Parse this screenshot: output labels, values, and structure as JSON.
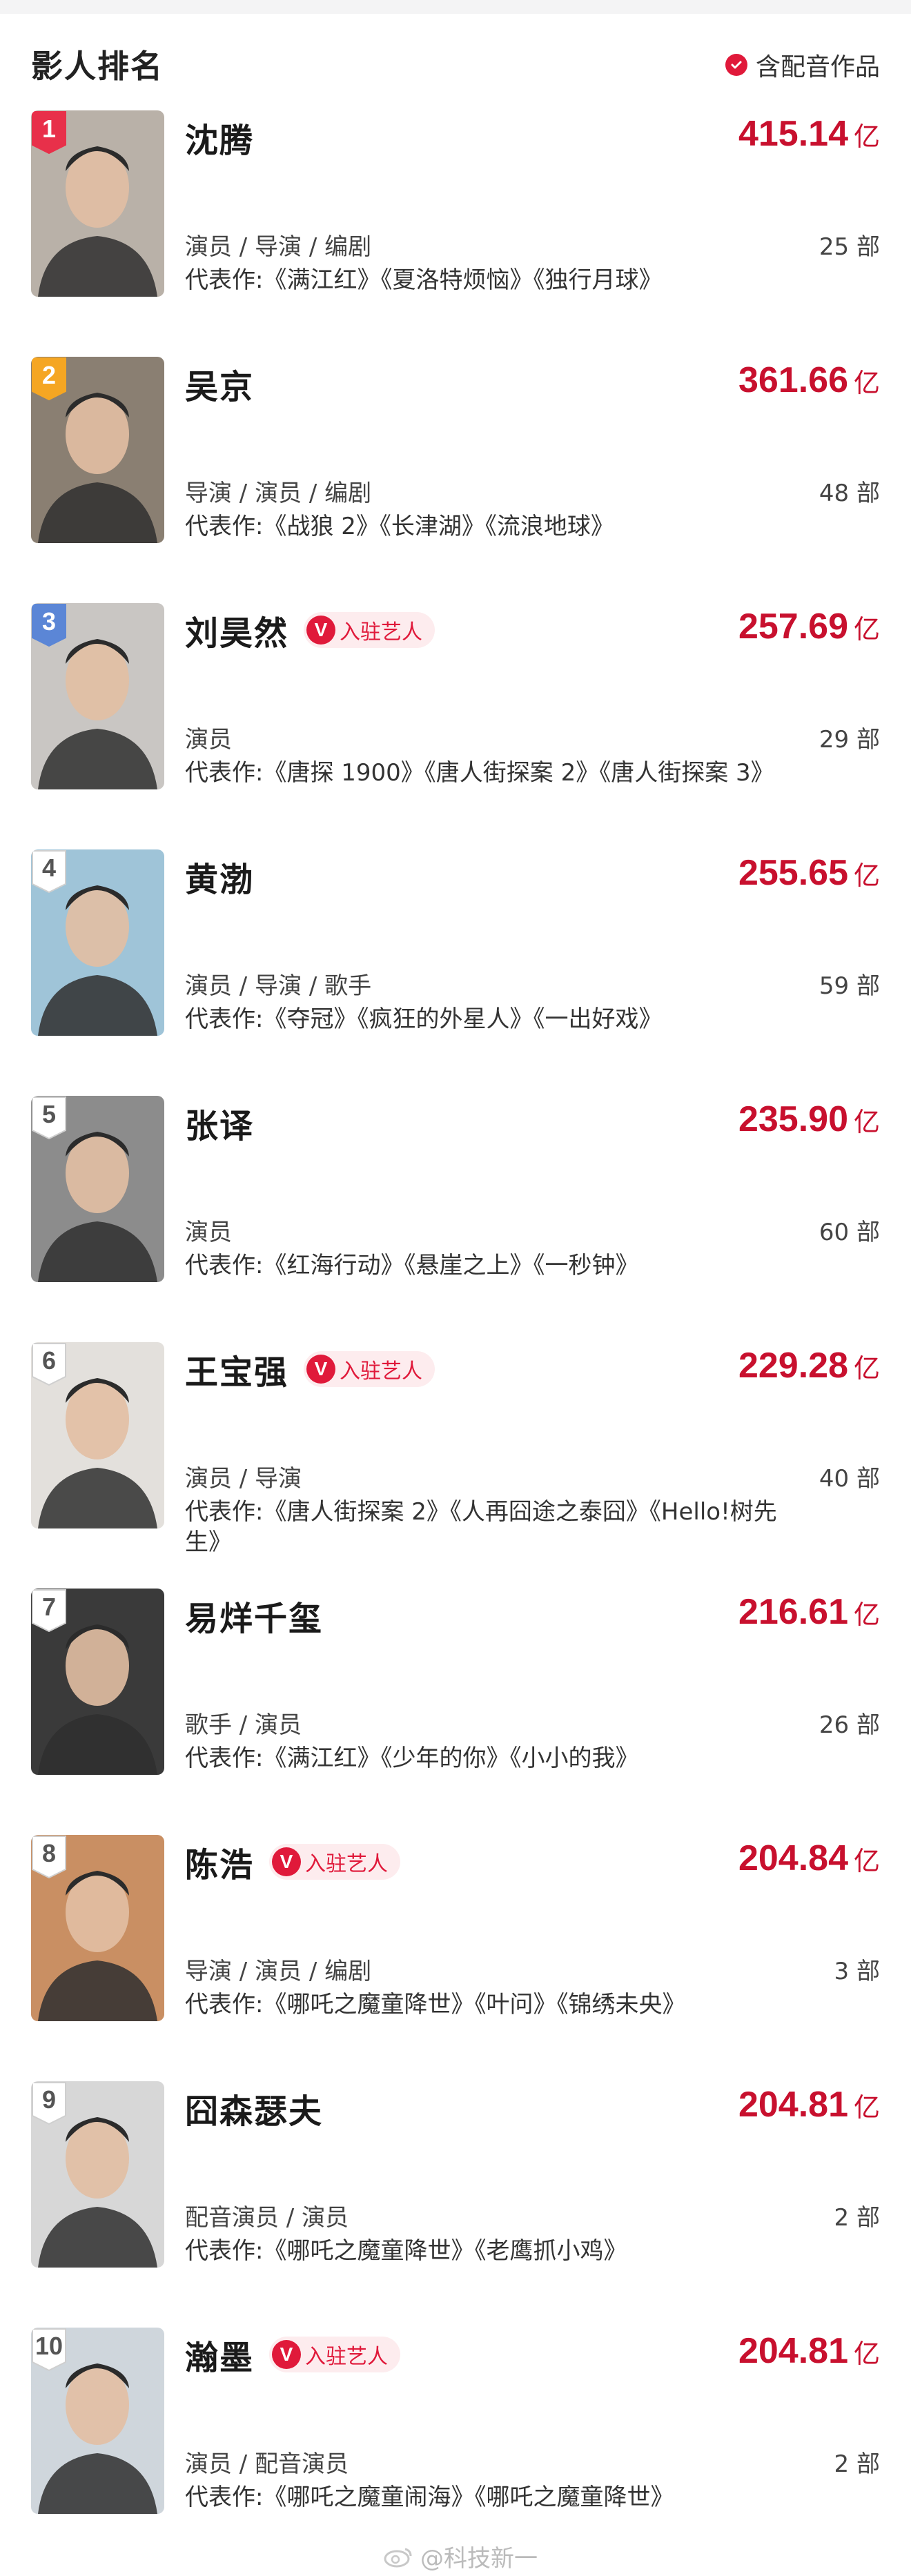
{
  "header": {
    "title": "影人排名",
    "filter_label": "含配音作品"
  },
  "colors": {
    "accent": "#c8102e",
    "badge_red": "#e8304a",
    "badge_orange": "#f5a623",
    "badge_blue": "#5b86d6",
    "badge_plain": "#ffffff"
  },
  "verified_label": "入驻艺人",
  "verified_v": "V",
  "box_unit": "亿",
  "rows": [
    {
      "rank": "1",
      "name": "沈腾",
      "box": "415.14",
      "roles": "演员 / 导演 / 编剧",
      "count": "25 部",
      "works": "代表作:《满江红》《夏洛特烦恼》《独行月球》",
      "verified": false,
      "badge": "red",
      "photo": "#b9b1a8"
    },
    {
      "rank": "2",
      "name": "吴京",
      "box": "361.66",
      "roles": "导演 / 演员 / 编剧",
      "count": "48 部",
      "works": "代表作:《战狼 2》《长津湖》《流浪地球》",
      "verified": false,
      "badge": "orange",
      "photo": "#8a7f72"
    },
    {
      "rank": "3",
      "name": "刘昊然",
      "box": "257.69",
      "roles": "演员",
      "count": "29 部",
      "works": "代表作:《唐探 1900》《唐人街探案 2》《唐人街探案 3》",
      "verified": true,
      "badge": "blue",
      "photo": "#c9c6c3"
    },
    {
      "rank": "4",
      "name": "黄渤",
      "box": "255.65",
      "roles": "演员 / 导演 / 歌手",
      "count": "59 部",
      "works": "代表作:《夺冠》《疯狂的外星人》《一出好戏》",
      "verified": false,
      "badge": "plain",
      "photo": "#9fc4d8"
    },
    {
      "rank": "5",
      "name": "张译",
      "box": "235.90",
      "roles": "演员",
      "count": "60 部",
      "works": "代表作:《红海行动》《悬崖之上》《一秒钟》",
      "verified": false,
      "badge": "plain",
      "photo": "#8c8c8c"
    },
    {
      "rank": "6",
      "name": "王宝强",
      "box": "229.28",
      "roles": "演员 / 导演",
      "count": "40 部",
      "works": "代表作:《唐人街探案 2》《人再囧途之泰囧》《Hello!树先生》",
      "verified": true,
      "badge": "plain",
      "photo": "#e3e0dc"
    },
    {
      "rank": "7",
      "name": "易烊千玺",
      "box": "216.61",
      "roles": "歌手 / 演员",
      "count": "26 部",
      "works": "代表作:《满江红》《少年的你》《小小的我》",
      "verified": false,
      "badge": "plain",
      "photo": "#3a3a3a"
    },
    {
      "rank": "8",
      "name": "陈浩",
      "box": "204.84",
      "roles": "导演 / 演员 / 编剧",
      "count": "3 部",
      "works": "代表作:《哪吒之魔童降世》《叶问》《锦绣未央》",
      "verified": true,
      "badge": "plain",
      "photo": "#c98f63"
    },
    {
      "rank": "9",
      "name": "囧森瑟夫",
      "box": "204.81",
      "roles": "配音演员 / 演员",
      "count": "2 部",
      "works": "代表作:《哪吒之魔童降世》《老鹰抓小鸡》",
      "verified": false,
      "badge": "plain",
      "photo": "#d7d7d7"
    },
    {
      "rank": "10",
      "name": "瀚墨",
      "box": "204.81",
      "roles": "演员 / 配音演员",
      "count": "2 部",
      "works": "代表作:《哪吒之魔童闹海》《哪吒之魔童降世》",
      "verified": true,
      "badge": "plain",
      "photo": "#cfd6dc"
    }
  ],
  "watermark": "@科技新一"
}
